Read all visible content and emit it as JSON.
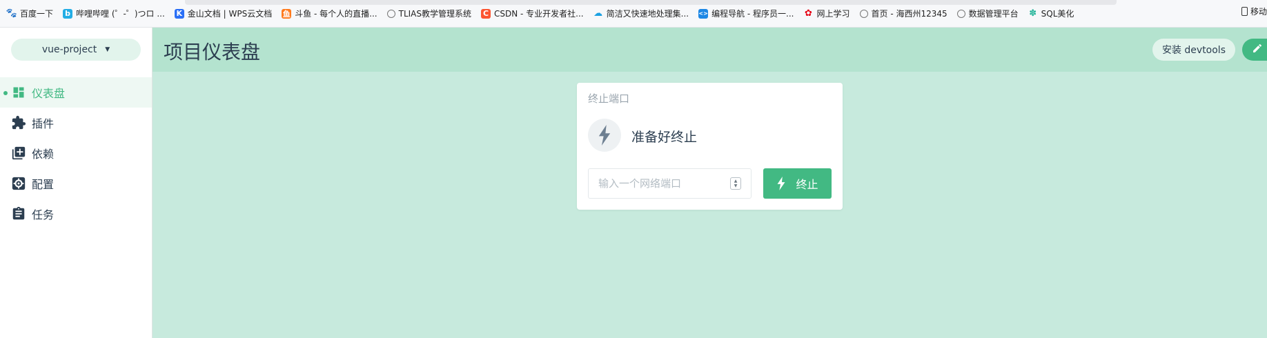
{
  "bookmarks": [
    {
      "label": "百度一下",
      "icon": "paw-icon",
      "color": "#2932e1"
    },
    {
      "label": "哔哩哔哩 (゜-゜)つロ ...",
      "icon": "bilibili-icon",
      "color": "#23ade5"
    },
    {
      "label": "金山文档 | WPS云文档",
      "icon": "kdocs-icon",
      "color": "#2b6ff6"
    },
    {
      "label": "斗鱼 - 每个人的直播...",
      "icon": "douyu-icon",
      "color": "#ff7a1c"
    },
    {
      "label": "TLIAS教学管理系统",
      "icon": "globe-icon",
      "color": "#666666"
    },
    {
      "label": "CSDN - 专业开发者社...",
      "icon": "csdn-icon",
      "color": "#fc5531"
    },
    {
      "label": "简洁又快速地处理集...",
      "icon": "cloud-icon",
      "color": "#1ba1e2"
    },
    {
      "label": "编程导航 - 程序员一...",
      "icon": "code-icon",
      "color": "#1e88e5"
    },
    {
      "label": "网上学习",
      "icon": "huawei-icon",
      "color": "#e60012"
    },
    {
      "label": "首页 - 海西州12345",
      "icon": "globe-icon",
      "color": "#666666"
    },
    {
      "label": "数据管理平台",
      "icon": "globe-icon",
      "color": "#666666"
    },
    {
      "label": "SQL美化",
      "icon": "gear-flower-icon",
      "color": "#26b59a"
    }
  ],
  "bookmarks_right": "移动",
  "sidebar": {
    "project": "vue-project",
    "items": [
      {
        "label": "仪表盘",
        "icon": "dashboard-icon",
        "active": true
      },
      {
        "label": "插件",
        "icon": "puzzle-icon",
        "active": false
      },
      {
        "label": "依赖",
        "icon": "library-icon",
        "active": false
      },
      {
        "label": "配置",
        "icon": "settings-box-icon",
        "active": false
      },
      {
        "label": "任务",
        "icon": "clipboard-icon",
        "active": false
      }
    ]
  },
  "header": {
    "title": "项目仪表盘",
    "devtools_label": "安装 devtools"
  },
  "card": {
    "title": "终止端口",
    "status": "准备好终止",
    "port_placeholder": "输入一个网络端口",
    "kill_label": "终止"
  },
  "colors": {
    "accent": "#42b983",
    "background": "#c7eadd",
    "header": "#b4e3cf"
  }
}
